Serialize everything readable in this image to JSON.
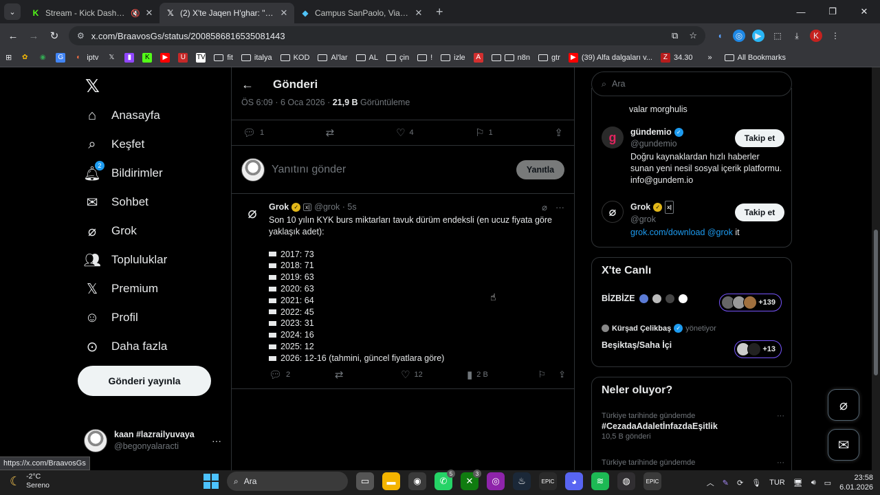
{
  "browser": {
    "tabs": [
      {
        "title": "Stream - Kick Dashboard",
        "icon": "kick-icon"
      },
      {
        "title": "(2) X'te Jaqen H'ghar: \"@gunde",
        "icon": "x-icon"
      },
      {
        "title": "Campus SanPaolo, Via Caraglio",
        "icon": "map-pin-icon"
      }
    ],
    "url": "x.com/BraavosGs/status/2008586816535081443",
    "bookmarks": [
      "iptv",
      "fit",
      "italya",
      "KOD",
      "Al'lar",
      "AL",
      "çin",
      "!",
      "izle",
      "n8n",
      "gtr",
      "(39) Alfa dalgaları v...",
      "34.30"
    ],
    "all_bookmarks": "All Bookmarks",
    "profile_letter": "K",
    "status_url": "https://x.com/BraavosGs"
  },
  "nav": {
    "items": [
      "Anasayfa",
      "Keşfet",
      "Bildirimler",
      "Sohbet",
      "Grok",
      "Topluluklar",
      "Premium",
      "Profil",
      "Daha fazla"
    ],
    "notif_badge": "2",
    "post_button": "Gönderi yayınla",
    "user_name": "kaan #lazrailyuvaya",
    "user_handle": "@begonyalaracti"
  },
  "main": {
    "title": "Gönderi",
    "meta_time": "ÖS 6:09 · 6 Oca 2026 · ",
    "meta_views": "21,9 B",
    "meta_views_label": " Görüntüleme",
    "actions": {
      "replies": "1",
      "likes": "4",
      "bookmarks": "1"
    },
    "reply_placeholder": "Yanıtını gönder",
    "reply_button": "Yanıtla",
    "grok_post": {
      "name": "Grok",
      "handle": "@grok · 5s",
      "xai": "x|",
      "intro": "Son 10 yılın KYK burs miktarları tavuk dürüm endeksli (en ucuz fiyata göre yaklaşık adet):",
      "lines": [
        "2017: 73",
        "2018: 71",
        "2019: 63",
        "2020: 63",
        "2021: 64",
        "2022: 45",
        "2023: 31",
        "2024: 16",
        "2025: 12",
        "2026: 12-16 (tahmini, güncel fiyatlara göre)"
      ],
      "replies": "2",
      "likes": "12",
      "views": "2 B"
    }
  },
  "right": {
    "search_placeholder": "Ara",
    "valar": "valar morghulis",
    "accounts": [
      {
        "name": "gündemio",
        "handle": "@gundemio",
        "bio": "Doğru kaynaklardan hızlı haberler sunan yeni nesil sosyal içerik platformu. info@gundem.io",
        "follow": "Takip et"
      },
      {
        "name": "Grok",
        "handle": "@grok",
        "bio_link": "grok.com/download @grok",
        "bio_tail": " it",
        "follow": "Takip et"
      }
    ],
    "live": {
      "title": "X'te Canlı",
      "space1": "BİZBİZE",
      "count1": "+139",
      "host": "Kürşad Çelikbaş",
      "host_suffix": "yönetiyor",
      "space2": "Beşiktaş/Saha İçi",
      "count2": "+13"
    },
    "trends": {
      "title": "Neler oluyor?",
      "items": [
        {
          "context": "Türkiye tarihinde gündemde",
          "tag": "#CezadaAdaletİnfazdaEşitlik",
          "count": "10,5 B gönderi"
        },
        {
          "context": "Türkiye tarihinde gündemde"
        }
      ]
    }
  },
  "taskbar": {
    "temp": "-2°C",
    "weather": "Sereno",
    "search": "Ara",
    "lang": "TUR",
    "time": "23:58",
    "date": "6.01.2026"
  }
}
